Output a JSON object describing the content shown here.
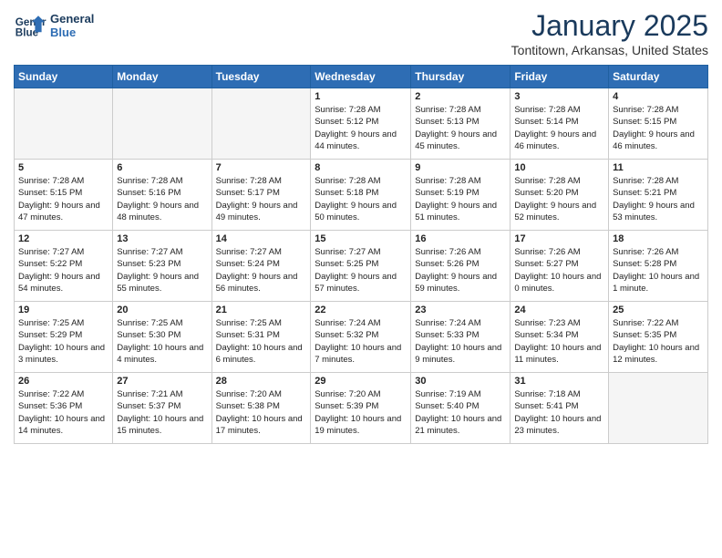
{
  "header": {
    "logo_line1": "General",
    "logo_line2": "Blue",
    "month_title": "January 2025",
    "location": "Tontitown, Arkansas, United States"
  },
  "weekdays": [
    "Sunday",
    "Monday",
    "Tuesday",
    "Wednesday",
    "Thursday",
    "Friday",
    "Saturday"
  ],
  "weeks": [
    [
      {
        "num": "",
        "info": ""
      },
      {
        "num": "",
        "info": ""
      },
      {
        "num": "",
        "info": ""
      },
      {
        "num": "1",
        "info": "Sunrise: 7:28 AM\nSunset: 5:12 PM\nDaylight: 9 hours and 44 minutes."
      },
      {
        "num": "2",
        "info": "Sunrise: 7:28 AM\nSunset: 5:13 PM\nDaylight: 9 hours and 45 minutes."
      },
      {
        "num": "3",
        "info": "Sunrise: 7:28 AM\nSunset: 5:14 PM\nDaylight: 9 hours and 46 minutes."
      },
      {
        "num": "4",
        "info": "Sunrise: 7:28 AM\nSunset: 5:15 PM\nDaylight: 9 hours and 46 minutes."
      }
    ],
    [
      {
        "num": "5",
        "info": "Sunrise: 7:28 AM\nSunset: 5:15 PM\nDaylight: 9 hours and 47 minutes."
      },
      {
        "num": "6",
        "info": "Sunrise: 7:28 AM\nSunset: 5:16 PM\nDaylight: 9 hours and 48 minutes."
      },
      {
        "num": "7",
        "info": "Sunrise: 7:28 AM\nSunset: 5:17 PM\nDaylight: 9 hours and 49 minutes."
      },
      {
        "num": "8",
        "info": "Sunrise: 7:28 AM\nSunset: 5:18 PM\nDaylight: 9 hours and 50 minutes."
      },
      {
        "num": "9",
        "info": "Sunrise: 7:28 AM\nSunset: 5:19 PM\nDaylight: 9 hours and 51 minutes."
      },
      {
        "num": "10",
        "info": "Sunrise: 7:28 AM\nSunset: 5:20 PM\nDaylight: 9 hours and 52 minutes."
      },
      {
        "num": "11",
        "info": "Sunrise: 7:28 AM\nSunset: 5:21 PM\nDaylight: 9 hours and 53 minutes."
      }
    ],
    [
      {
        "num": "12",
        "info": "Sunrise: 7:27 AM\nSunset: 5:22 PM\nDaylight: 9 hours and 54 minutes."
      },
      {
        "num": "13",
        "info": "Sunrise: 7:27 AM\nSunset: 5:23 PM\nDaylight: 9 hours and 55 minutes."
      },
      {
        "num": "14",
        "info": "Sunrise: 7:27 AM\nSunset: 5:24 PM\nDaylight: 9 hours and 56 minutes."
      },
      {
        "num": "15",
        "info": "Sunrise: 7:27 AM\nSunset: 5:25 PM\nDaylight: 9 hours and 57 minutes."
      },
      {
        "num": "16",
        "info": "Sunrise: 7:26 AM\nSunset: 5:26 PM\nDaylight: 9 hours and 59 minutes."
      },
      {
        "num": "17",
        "info": "Sunrise: 7:26 AM\nSunset: 5:27 PM\nDaylight: 10 hours and 0 minutes."
      },
      {
        "num": "18",
        "info": "Sunrise: 7:26 AM\nSunset: 5:28 PM\nDaylight: 10 hours and 1 minute."
      }
    ],
    [
      {
        "num": "19",
        "info": "Sunrise: 7:25 AM\nSunset: 5:29 PM\nDaylight: 10 hours and 3 minutes."
      },
      {
        "num": "20",
        "info": "Sunrise: 7:25 AM\nSunset: 5:30 PM\nDaylight: 10 hours and 4 minutes."
      },
      {
        "num": "21",
        "info": "Sunrise: 7:25 AM\nSunset: 5:31 PM\nDaylight: 10 hours and 6 minutes."
      },
      {
        "num": "22",
        "info": "Sunrise: 7:24 AM\nSunset: 5:32 PM\nDaylight: 10 hours and 7 minutes."
      },
      {
        "num": "23",
        "info": "Sunrise: 7:24 AM\nSunset: 5:33 PM\nDaylight: 10 hours and 9 minutes."
      },
      {
        "num": "24",
        "info": "Sunrise: 7:23 AM\nSunset: 5:34 PM\nDaylight: 10 hours and 11 minutes."
      },
      {
        "num": "25",
        "info": "Sunrise: 7:22 AM\nSunset: 5:35 PM\nDaylight: 10 hours and 12 minutes."
      }
    ],
    [
      {
        "num": "26",
        "info": "Sunrise: 7:22 AM\nSunset: 5:36 PM\nDaylight: 10 hours and 14 minutes."
      },
      {
        "num": "27",
        "info": "Sunrise: 7:21 AM\nSunset: 5:37 PM\nDaylight: 10 hours and 15 minutes."
      },
      {
        "num": "28",
        "info": "Sunrise: 7:20 AM\nSunset: 5:38 PM\nDaylight: 10 hours and 17 minutes."
      },
      {
        "num": "29",
        "info": "Sunrise: 7:20 AM\nSunset: 5:39 PM\nDaylight: 10 hours and 19 minutes."
      },
      {
        "num": "30",
        "info": "Sunrise: 7:19 AM\nSunset: 5:40 PM\nDaylight: 10 hours and 21 minutes."
      },
      {
        "num": "31",
        "info": "Sunrise: 7:18 AM\nSunset: 5:41 PM\nDaylight: 10 hours and 23 minutes."
      },
      {
        "num": "",
        "info": ""
      }
    ]
  ]
}
